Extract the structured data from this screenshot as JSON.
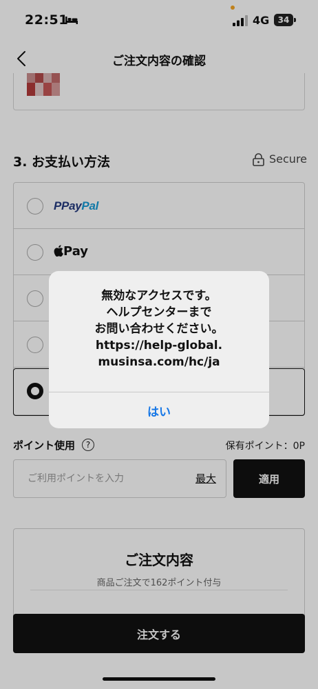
{
  "status_bar": {
    "time": "22:51",
    "network": "4G",
    "battery": "34"
  },
  "header": {
    "title": "ご注文内容の確認"
  },
  "payment": {
    "section_title": "3. お支払い方法",
    "secure_label": "Secure",
    "paypal_part1": "Pay",
    "paypal_part2": "Pal",
    "applepay_label": "Pay"
  },
  "points": {
    "label": "ポイント使用",
    "help_glyph": "?",
    "owned": "保有ポイント：0P",
    "input_placeholder": "ご利用ポイントを入力",
    "max_label": "最大",
    "apply_label": "適用"
  },
  "summary": {
    "title": "ご注文内容",
    "subtitle": "商品ご注文で162ポイント付与"
  },
  "order_button": {
    "label": "注文する"
  },
  "alert": {
    "line1": "無効なアクセスです。",
    "line2": "ヘルプセンターまで",
    "line3": "お問い合わせください。",
    "line4": "https://help-global.",
    "line5": "musinsa.com/hc/ja",
    "button_label": "はい"
  }
}
